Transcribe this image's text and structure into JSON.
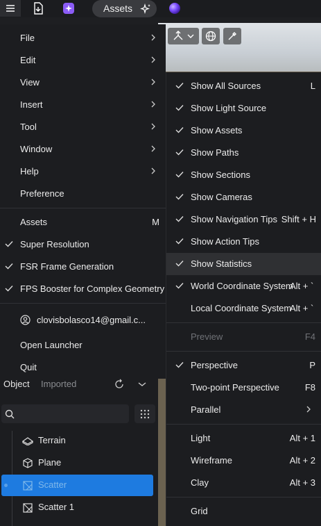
{
  "topbar": {
    "assets_label": "Assets"
  },
  "main_menu": {
    "items": [
      {
        "label": "File"
      },
      {
        "label": "Edit"
      },
      {
        "label": "View"
      },
      {
        "label": "Insert"
      },
      {
        "label": "Tool"
      },
      {
        "label": "Window"
      },
      {
        "label": "Help"
      },
      {
        "label": "Preference"
      }
    ],
    "assets": {
      "label": "Assets",
      "shortcut": "M"
    },
    "toggles": [
      {
        "label": "Super Resolution"
      },
      {
        "label": "FSR Frame Generation"
      },
      {
        "label": "FPS Booster for Complex Geometry"
      }
    ],
    "account": "clovisbolasco14@gmail.c...",
    "open_launcher": "Open Launcher",
    "quit": "Quit"
  },
  "view_menu": {
    "show": [
      {
        "label": "Show All Sources",
        "shortcut": "L"
      },
      {
        "label": "Show Light Source",
        "shortcut": ""
      },
      {
        "label": "Show Assets",
        "shortcut": ""
      },
      {
        "label": "Show Paths",
        "shortcut": ""
      },
      {
        "label": "Show Sections",
        "shortcut": ""
      },
      {
        "label": "Show Cameras",
        "shortcut": ""
      },
      {
        "label": "Show Navigation Tips",
        "shortcut": "Shift + H"
      },
      {
        "label": "Show Action Tips",
        "shortcut": ""
      },
      {
        "label": "Show Statistics",
        "shortcut": ""
      },
      {
        "label": "World Coordinate System",
        "shortcut": "Alt + `"
      },
      {
        "label": "Local Coordinate System",
        "shortcut": "Alt + `"
      }
    ],
    "preview": {
      "label": "Preview",
      "shortcut": "F4"
    },
    "projection": [
      {
        "label": "Perspective",
        "shortcut": "P"
      },
      {
        "label": "Two-point Perspective",
        "shortcut": "F8"
      },
      {
        "label": "Parallel",
        "shortcut": ""
      }
    ],
    "render_modes": [
      {
        "label": "Light",
        "shortcut": "Alt + 1"
      },
      {
        "label": "Wireframe",
        "shortcut": "Alt + 2"
      },
      {
        "label": "Clay",
        "shortcut": "Alt + 3"
      }
    ],
    "grid": {
      "label": "Grid"
    }
  },
  "panel": {
    "tab_object": "Object",
    "tab_imported": "Imported",
    "tree": [
      {
        "name": "Terrain",
        "icon": "terrain-icon"
      },
      {
        "name": "Plane",
        "icon": "cube-icon"
      },
      {
        "name": "Scatter",
        "icon": "scatter-icon",
        "selected": true
      },
      {
        "name": "Scatter 1",
        "icon": "scatter-icon"
      }
    ]
  }
}
